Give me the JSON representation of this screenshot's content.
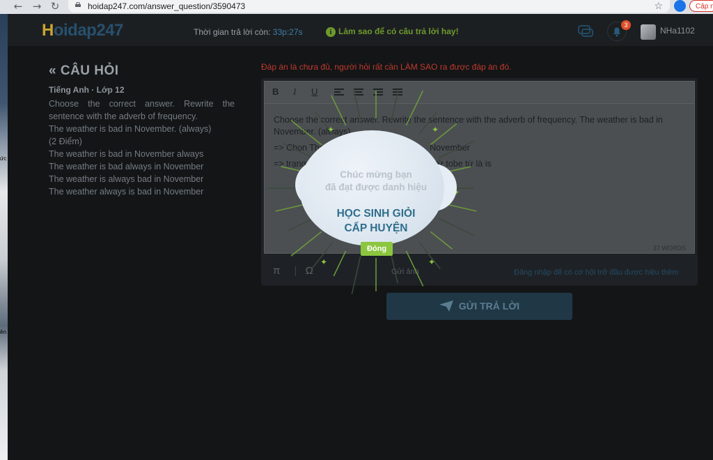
{
  "browser": {
    "url": "hoidap247.com/answer_question/3590473",
    "update_label": "Cập n",
    "back_glyph": "←",
    "forward_glyph": "→",
    "reload_glyph": "↻",
    "star_glyph": "☆"
  },
  "desktop": {
    "label_1": "ức",
    "label_2": "ên"
  },
  "header": {
    "logo_h": "H",
    "logo_rest": "oidap247",
    "timer_label": "Thời gian trả lời còn: ",
    "timer_value": "33p:27s",
    "tip_icon": "i",
    "tip_text": "Làm sao để có câu trả lời hay!",
    "notification_count": "3",
    "username": "NHa1102"
  },
  "question": {
    "heading_icon": "«",
    "heading": "CÂU HỎI",
    "subject": "Tiếng Anh · Lớp 12",
    "prompt": "Choose the correct answer. Rewrite the sentence with the adverb of frequency.",
    "sentence": "The weather is bad in November. (always)",
    "points": "(2 Điểm)",
    "options": [
      "The weather is bad in November always",
      "The weather is bad always in November",
      "The weather is always bad in November",
      "The weather always is bad in November"
    ]
  },
  "answer": {
    "warning": "Đáp án là chưa đủ, người hỏi rất cần LÀM SAO ra được đáp án đó.",
    "toolbar": [
      "B",
      "I",
      "U"
    ],
    "text_line_1": "Choose the correct answer. Rewrite the sentence with the adverb of frequency. The weather is bad in November. (always)",
    "text_line_2": "=> Chọn The w                                        November",
    "text_line_3": "=> trạng từ                                          ộng từ tobe từ là is",
    "word_count": "37 WORDS",
    "pi_glyph": "π",
    "omega_glyph": "Ω",
    "attach_label": "Gửi ảnh",
    "bottom_link": "Đăng nhập để có cơ hội trở đầu được hiệu thêm",
    "submit_label": "GỬI TRẢ LỜI"
  },
  "popup": {
    "congrats_line1": "Chúc mừng bạn",
    "congrats_line2": "đã đạt được danh hiệu",
    "title_line1": "HỌC SINH GIỎI",
    "title_line2": "CẤP HUYỆN",
    "close_label": "Đóng"
  }
}
